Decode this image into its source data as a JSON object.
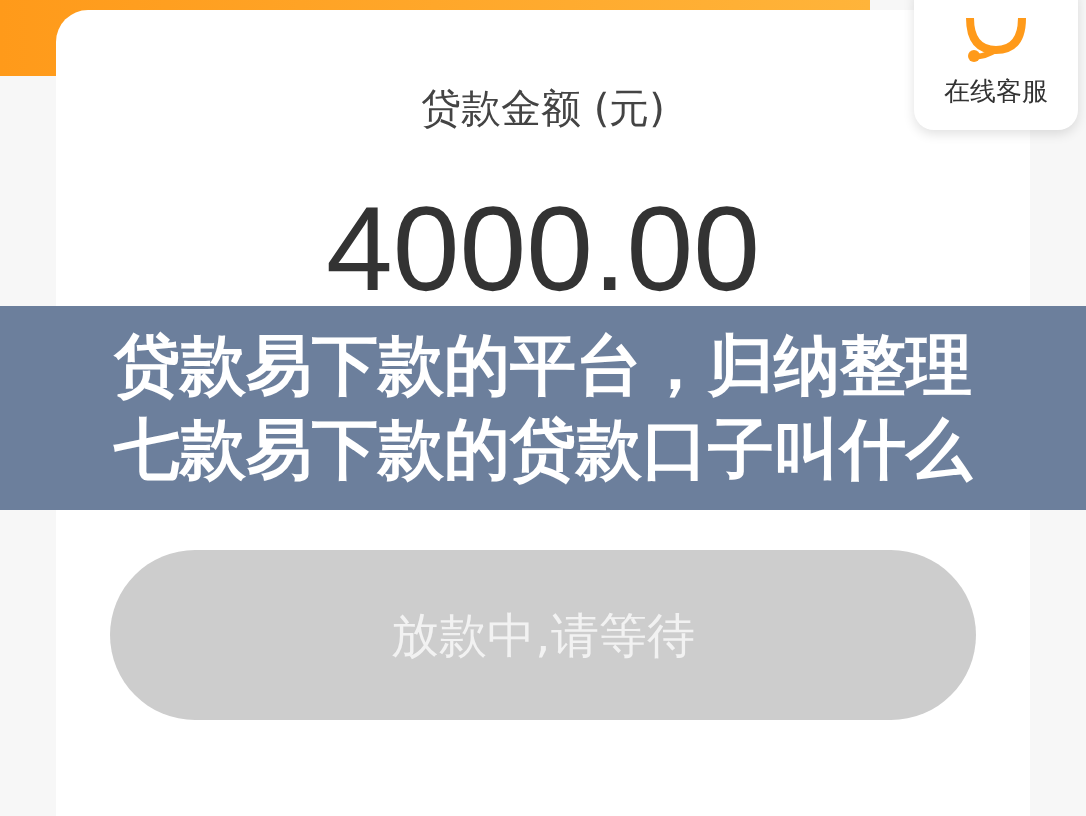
{
  "support": {
    "label": "在线客服"
  },
  "loan": {
    "label": "贷款金额 (元)",
    "amount": "4000.00"
  },
  "button": {
    "label": "放款中,请等待",
    "disabled": true
  },
  "banner": {
    "lines": [
      "贷款易下款的平台，归纳整理",
      "七款易下款的贷款口子叫什么"
    ]
  }
}
